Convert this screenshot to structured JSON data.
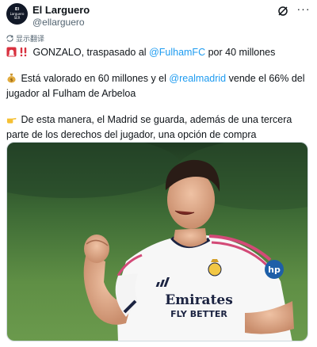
{
  "header": {
    "display_name": "El Larguero",
    "handle": "@ellarguero",
    "avatar_lines": [
      "El",
      "Larguero",
      "SER"
    ]
  },
  "translate": {
    "label": "显示翻译"
  },
  "tweet": {
    "line1_rest": " GONZALO, traspasado al ",
    "mention1": "@FulhamFC",
    "line1_end": " por 40 millones",
    "line2_start": " Está valorado en 60 millones y el ",
    "mention2": "@realmadrid",
    "line2_end": " vende el 66% del jugador al Fulham de Arbeloa",
    "line3": " De esta manera, el Madrid se guarda, además de una tercera parte de los derechos del jugador, una opción de compra"
  },
  "media": {
    "shirt_sponsor_line1": "Emirates",
    "shirt_sponsor_line2": "FLY BETTER",
    "sleeve_badge": "hp"
  },
  "icons": {
    "siren": "siren-icon",
    "exclamation": "double-exclamation-icon",
    "money_bag": "money-bag-icon",
    "pointing_hand": "pointing-right-icon",
    "grok": "grok-icon",
    "more": "more-icon",
    "translate": "translate-icon"
  }
}
